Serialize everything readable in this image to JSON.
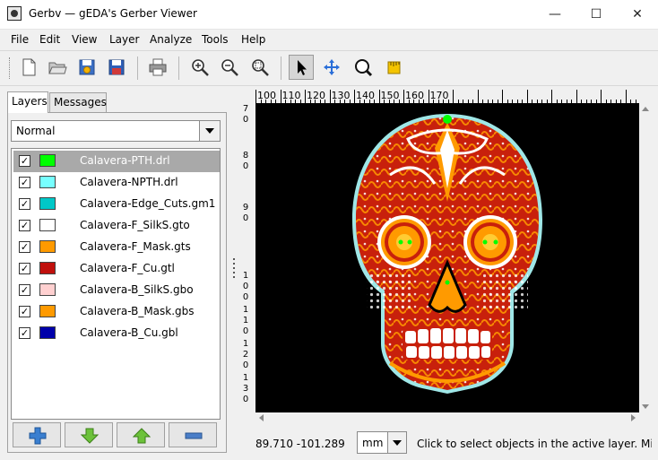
{
  "window": {
    "title": "Gerbv — gEDA's Gerber Viewer",
    "controls": {
      "minimize": "—",
      "maximize": "☐",
      "close": "✕"
    }
  },
  "menu": [
    "File",
    "Edit",
    "View",
    "Layer",
    "Analyze",
    "Tools",
    "Help"
  ],
  "toolbar": {
    "buttons": [
      "new-icon",
      "open-icon",
      "revert-icon",
      "save-icon",
      "print-icon",
      "zoom-in-icon",
      "zoom-out-icon",
      "zoom-fit-icon",
      "pointer-icon",
      "pan-icon",
      "zoom-region-icon",
      "measure-icon"
    ],
    "active_tool": "pointer-icon"
  },
  "sidebar": {
    "tabs": [
      {
        "label": "Layers",
        "active": true
      },
      {
        "label": "Messages",
        "active": false
      }
    ],
    "render_mode": "Normal",
    "layers": [
      {
        "name": "Calavera-PTH.drl",
        "color": "#00ff00",
        "checked": true,
        "selected": true
      },
      {
        "name": "Calavera-NPTH.drl",
        "color": "#77ffff",
        "checked": true,
        "selected": false
      },
      {
        "name": "Calavera-Edge_Cuts.gm1",
        "color": "#00c8c8",
        "checked": true,
        "selected": false
      },
      {
        "name": "Calavera-F_SilkS.gto",
        "color": "#ffffff",
        "checked": true,
        "selected": false
      },
      {
        "name": "Calavera-F_Mask.gts",
        "color": "#ff9a00",
        "checked": true,
        "selected": false
      },
      {
        "name": "Calavera-F_Cu.gtl",
        "color": "#c0100c",
        "checked": true,
        "selected": false
      },
      {
        "name": "Calavera-B_SilkS.gbo",
        "color": "#ffd0d0",
        "checked": true,
        "selected": false
      },
      {
        "name": "Calavera-B_Mask.gbs",
        "color": "#ff9a00",
        "checked": true,
        "selected": false
      },
      {
        "name": "Calavera-B_Cu.gbl",
        "color": "#0000aa",
        "checked": true,
        "selected": false
      }
    ],
    "check_mark": "✓",
    "buttons": [
      "add-layer-icon",
      "move-layer-down-icon",
      "move-layer-up-icon",
      "remove-layer-icon"
    ]
  },
  "ruler": {
    "h_labels": [
      "100",
      "110",
      "120",
      "130",
      "140",
      "150",
      "160",
      "170"
    ],
    "v_labels": [
      "7",
      "0",
      "8",
      "0",
      "9",
      "0",
      "1",
      "0",
      "0",
      "1",
      "1",
      "0",
      "1",
      "2",
      "0",
      "1",
      "3",
      "0"
    ]
  },
  "status": {
    "coordinates": "89.710 -101.289",
    "unit": "mm",
    "message": "Click to select objects in the active layer. Middle click and drag to pan."
  },
  "colors": {
    "canvas_bg": "#000000",
    "copper": "#c8200c",
    "mask": "#ff9a00",
    "silk": "#ffffff",
    "edge": "#00c8c8",
    "pth": "#00ff00"
  }
}
